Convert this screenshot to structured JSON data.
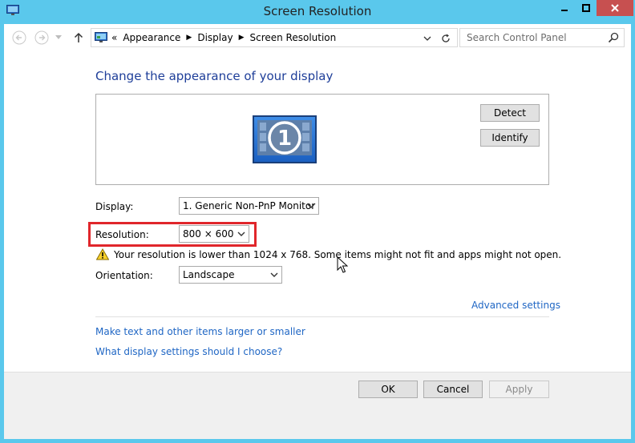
{
  "window": {
    "title": "Screen Resolution"
  },
  "address": {
    "prefix": "«",
    "crumbs": [
      "Appearance",
      "Display",
      "Screen Resolution"
    ]
  },
  "search": {
    "placeholder": "Search Control Panel"
  },
  "main": {
    "heading": "Change the appearance of your display",
    "monitor_number": "1",
    "detect_label": "Detect",
    "identify_label": "Identify",
    "display_label": "Display:",
    "display_value": "1. Generic Non-PnP Monitor",
    "resolution_label": "Resolution:",
    "resolution_value": "800 × 600",
    "warning_text": "Your resolution is lower than 1024 x 768. Some items might not fit and apps might not open.",
    "orientation_label": "Orientation:",
    "orientation_value": "Landscape",
    "advanced_link": "Advanced settings",
    "larger_text_link": "Make text and other items larger or smaller",
    "help_link": "What display settings should I choose?"
  },
  "footer": {
    "ok_label": "OK",
    "cancel_label": "Cancel",
    "apply_label": "Apply"
  },
  "colors": {
    "frame": "#5ac8ec",
    "heading": "#1e3e99",
    "link": "#1f66c4",
    "highlight": "#e0262b",
    "close_button": "#c75050"
  }
}
